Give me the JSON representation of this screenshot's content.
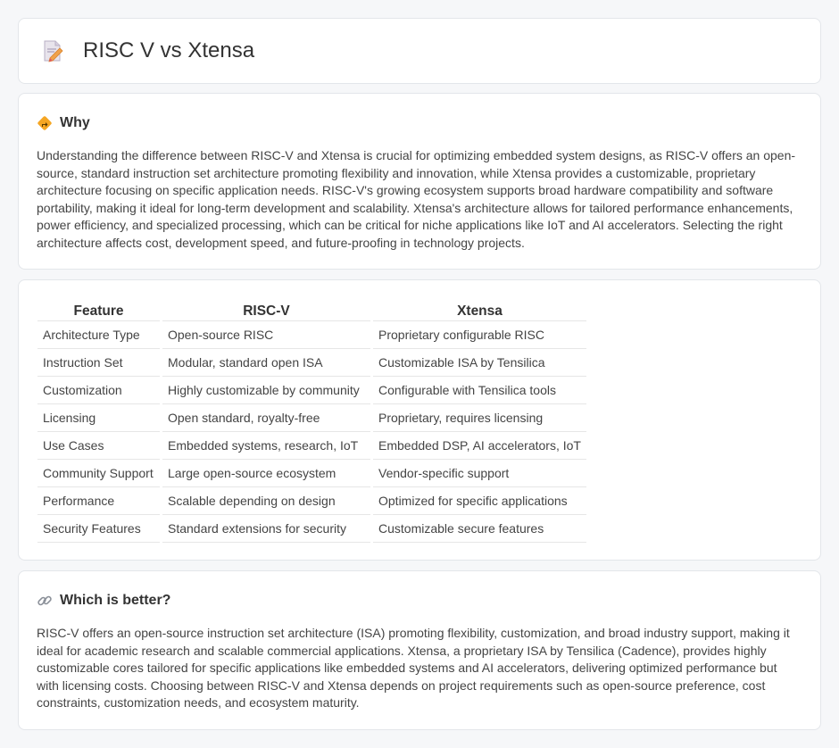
{
  "header": {
    "title": "RISC V vs Xtensa"
  },
  "why": {
    "title": "Why",
    "text": "Understanding the difference between RISC-V and Xtensa is crucial for optimizing embedded system designs, as RISC-V offers an open-source, standard instruction set architecture promoting flexibility and innovation, while Xtensa provides a customizable, proprietary architecture focusing on specific application needs. RISC-V's growing ecosystem supports broad hardware compatibility and software portability, making it ideal for long-term development and scalability. Xtensa's architecture allows for tailored performance enhancements, power efficiency, and specialized processing, which can be critical for niche applications like IoT and AI accelerators. Selecting the right architecture affects cost, development speed, and future-proofing in technology projects."
  },
  "comparison": {
    "headers": [
      "Feature",
      "RISC-V",
      "Xtensa"
    ],
    "rows": [
      [
        "Architecture Type",
        "Open-source RISC",
        "Proprietary configurable RISC"
      ],
      [
        "Instruction Set",
        "Modular, standard open ISA",
        "Customizable ISA by Tensilica"
      ],
      [
        "Customization",
        "Highly customizable by community",
        "Configurable with Tensilica tools"
      ],
      [
        "Licensing",
        "Open standard, royalty-free",
        "Proprietary, requires licensing"
      ],
      [
        "Use Cases",
        "Embedded systems, research, IoT",
        "Embedded DSP, AI accelerators, IoT"
      ],
      [
        "Community Support",
        "Large open-source ecosystem",
        "Vendor-specific support"
      ],
      [
        "Performance",
        "Scalable depending on design",
        "Optimized for specific applications"
      ],
      [
        "Security Features",
        "Standard extensions for security",
        "Customizable secure features"
      ]
    ]
  },
  "better": {
    "title": "Which is better?",
    "text": "RISC-V offers an open-source instruction set architecture (ISA) promoting flexibility, customization, and broad industry support, making it ideal for academic research and scalable commercial applications. Xtensa, a proprietary ISA by Tensilica (Cadence), provides highly customizable cores tailored for specific applications like embedded systems and AI accelerators, delivering optimized performance but with licensing costs. Choosing between RISC-V and Xtensa depends on project requirements such as open-source preference, cost constraints, customization needs, and ecosystem maturity."
  },
  "icons": {
    "title": "document-pencil-icon",
    "why": "diamond-direction-icon",
    "better": "link-icon"
  }
}
